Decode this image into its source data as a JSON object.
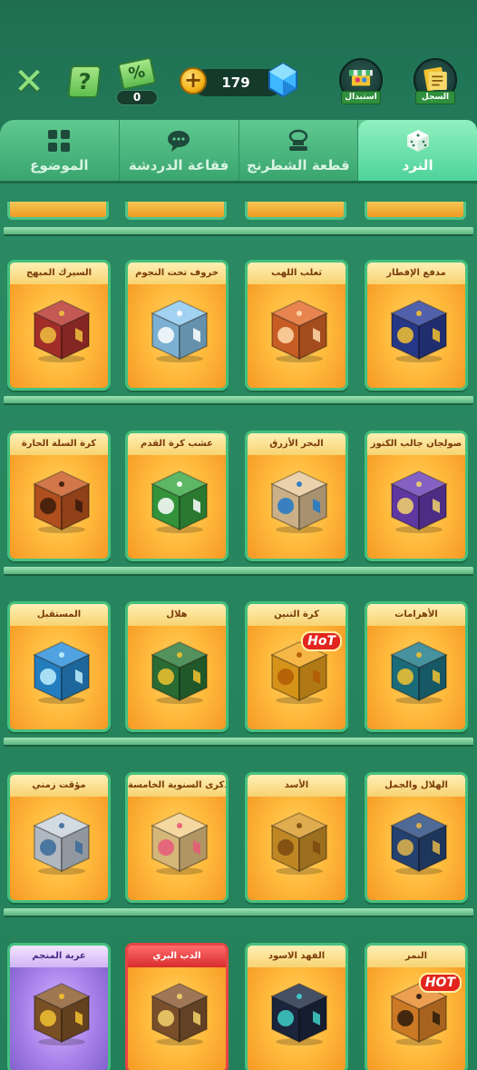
{
  "header": {
    "coupon_count": "0",
    "coupon_symbol": "%",
    "gem_count": "179",
    "exchange_label": "استبدال",
    "log_label": "السجل",
    "help_symbol": "?"
  },
  "tabs": [
    {
      "label": "الموضوع",
      "icon": "grid-icon",
      "active": false
    },
    {
      "label": "فقاعة الدردشة",
      "icon": "chat-bubble-icon",
      "active": false
    },
    {
      "label": "قطعة الشطرنج",
      "icon": "chess-piece-icon",
      "active": false
    },
    {
      "label": "النرد",
      "icon": "dice-icon",
      "active": true
    }
  ],
  "rows": [
    {
      "items": [
        {
          "name": "مدفع الإفطار",
          "color": "#2d3f9a",
          "accent": "#f2c230",
          "hot": false
        },
        {
          "name": "ثعلب اللهب",
          "color": "#e36a2a",
          "accent": "#ffd9a8",
          "hot": false
        },
        {
          "name": "خروف تحت النجوم",
          "color": "#8ec9ef",
          "accent": "#ffffff",
          "hot": false
        },
        {
          "name": "السيرك المبهج",
          "color": "#b8352f",
          "accent": "#f0c040",
          "hot": false
        }
      ]
    },
    {
      "items": [
        {
          "name": "صولجان جالب الكنوز",
          "color": "#6b3fb8",
          "accent": "#f2d36b",
          "hot": false
        },
        {
          "name": "البحر الأزرق",
          "color": "#e8c99a",
          "accent": "#1f78c9",
          "hot": false
        },
        {
          "name": "عشب كرة القدم",
          "color": "#3aa843",
          "accent": "#ffffff",
          "hot": false
        },
        {
          "name": "كرة السلة الحارة",
          "color": "#c85a22",
          "accent": "#3a1a0a",
          "hot": false
        }
      ]
    },
    {
      "items": [
        {
          "name": "الأهرامات",
          "color": "#1f7a8a",
          "accent": "#f2c230",
          "hot": false
        },
        {
          "name": "كرة التنين",
          "color": "#f4a81e",
          "accent": "#b25a05",
          "hot": true,
          "hot_label": "HoT"
        },
        {
          "name": "هلال",
          "color": "#2f7a3a",
          "accent": "#f2c230",
          "hot": false
        },
        {
          "name": "المستقبل",
          "color": "#2a8fd9",
          "accent": "#bff0ff",
          "hot": false
        }
      ]
    },
    {
      "items": [
        {
          "name": "الهلال والجمل",
          "color": "#2a4a80",
          "accent": "#e3b54a",
          "hot": false
        },
        {
          "name": "الأسد",
          "color": "#d99a2a",
          "accent": "#7a4a10",
          "hot": false
        },
        {
          "name": "الذكرى السنوية الخامسة",
          "color": "#f3d08a",
          "accent": "#e85a7a",
          "hot": false
        },
        {
          "name": "مؤقت زمني",
          "color": "#c9d2dc",
          "accent": "#3a6a9a",
          "hot": false
        }
      ]
    },
    {
      "items": [
        {
          "name": "النمر",
          "color": "#e88a2a",
          "accent": "#2a1a0a",
          "hot": true,
          "hot_label": "HOT"
        },
        {
          "name": "الفهد الاسود",
          "color": "#1e2a44",
          "accent": "#3fd0c9",
          "hot": false
        },
        {
          "name": "الدب البري",
          "color": "#8a5a32",
          "accent": "#f2d36b",
          "hot": false,
          "style": "red"
        },
        {
          "name": "عربة المنجم",
          "color": "#8a5a2a",
          "accent": "#f2c230",
          "hot": false,
          "style": "purple"
        }
      ]
    }
  ],
  "colors": {
    "background": "#227a5a",
    "tab_active": "#6be3ac",
    "card_border": "#45c07f",
    "card_fill": "#ffba3c"
  }
}
